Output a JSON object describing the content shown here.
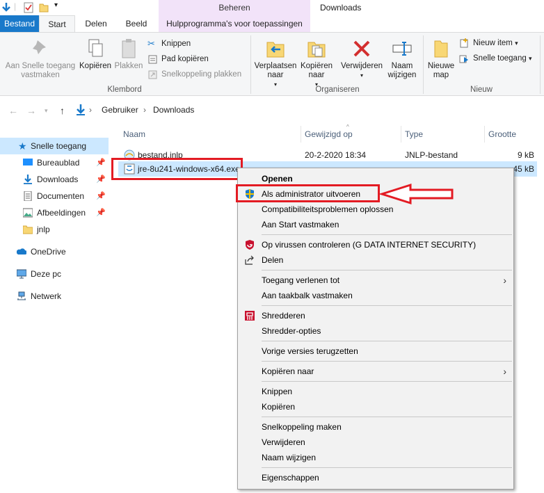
{
  "window": {
    "title": "Downloads",
    "context_tab_group": "Beheren"
  },
  "tabs": {
    "file": "Bestand",
    "start": "Start",
    "share": "Delen",
    "view": "Beeld",
    "tools": "Hulpprogramma's voor toepassingen"
  },
  "ribbon": {
    "pin_quick": "Aan Snelle toegang vastmaken",
    "copy": "Kopiëren",
    "paste": "Plakken",
    "cut": "Knippen",
    "copy_path": "Pad kopiëren",
    "paste_shortcut": "Snelkoppeling plakken",
    "group_clipboard": "Klembord",
    "move_to": "Verplaatsen naar",
    "copy_to": "Kopiëren naar",
    "delete": "Verwijderen",
    "rename": "Naam wijzigen",
    "group_organize": "Organiseren",
    "new_folder": "Nieuwe map",
    "new_item": "Nieuw item",
    "easy_access": "Snelle toegang",
    "group_new": "Nieuw"
  },
  "address": {
    "crumb1": "Gebruiker",
    "crumb2": "Downloads"
  },
  "sidebar": {
    "items": [
      {
        "label": "Snelle toegang"
      },
      {
        "label": "Bureaublad"
      },
      {
        "label": "Downloads"
      },
      {
        "label": "Documenten"
      },
      {
        "label": "Afbeeldingen"
      },
      {
        "label": "jnlp"
      },
      {
        "label": "OneDrive"
      },
      {
        "label": "Deze pc"
      },
      {
        "label": "Netwerk"
      }
    ]
  },
  "list": {
    "headers": {
      "name": "Naam",
      "modified": "Gewijzigd op",
      "type": "Type",
      "size": "Grootte"
    },
    "rows": [
      {
        "name": "bestand.jnlp",
        "modified": "20-2-2020 18:34",
        "type": "JNLP-bestand",
        "size": "9 kB"
      },
      {
        "name": "jre-8u241-windows-x64.exe",
        "modified": "",
        "type": "",
        "size": "45 kB"
      }
    ]
  },
  "context_menu": {
    "open": "Openen",
    "run_admin": "Als administrator uitvoeren",
    "compat": "Compatibiliteitsproblemen oplossen",
    "pin_start": "Aan Start vastmaken",
    "virus_scan": "Op virussen controleren (G DATA INTERNET SECURITY)",
    "share": "Delen",
    "grant_access": "Toegang verlenen tot",
    "pin_taskbar": "Aan taakbalk vastmaken",
    "shred": "Shredderen",
    "shred_options": "Shredder-opties",
    "prev_versions": "Vorige versies terugzetten",
    "copy_to": "Kopiëren naar",
    "cut": "Knippen",
    "copy": "Kopiëren",
    "create_shortcut": "Snelkoppeling maken",
    "delete": "Verwijderen",
    "rename": "Naam wijzigen",
    "properties": "Eigenschappen"
  },
  "colors": {
    "accent": "#1979ca",
    "selection": "#cce8ff",
    "annotation": "#e31b23",
    "tools_tab": "#f2e3f9"
  }
}
